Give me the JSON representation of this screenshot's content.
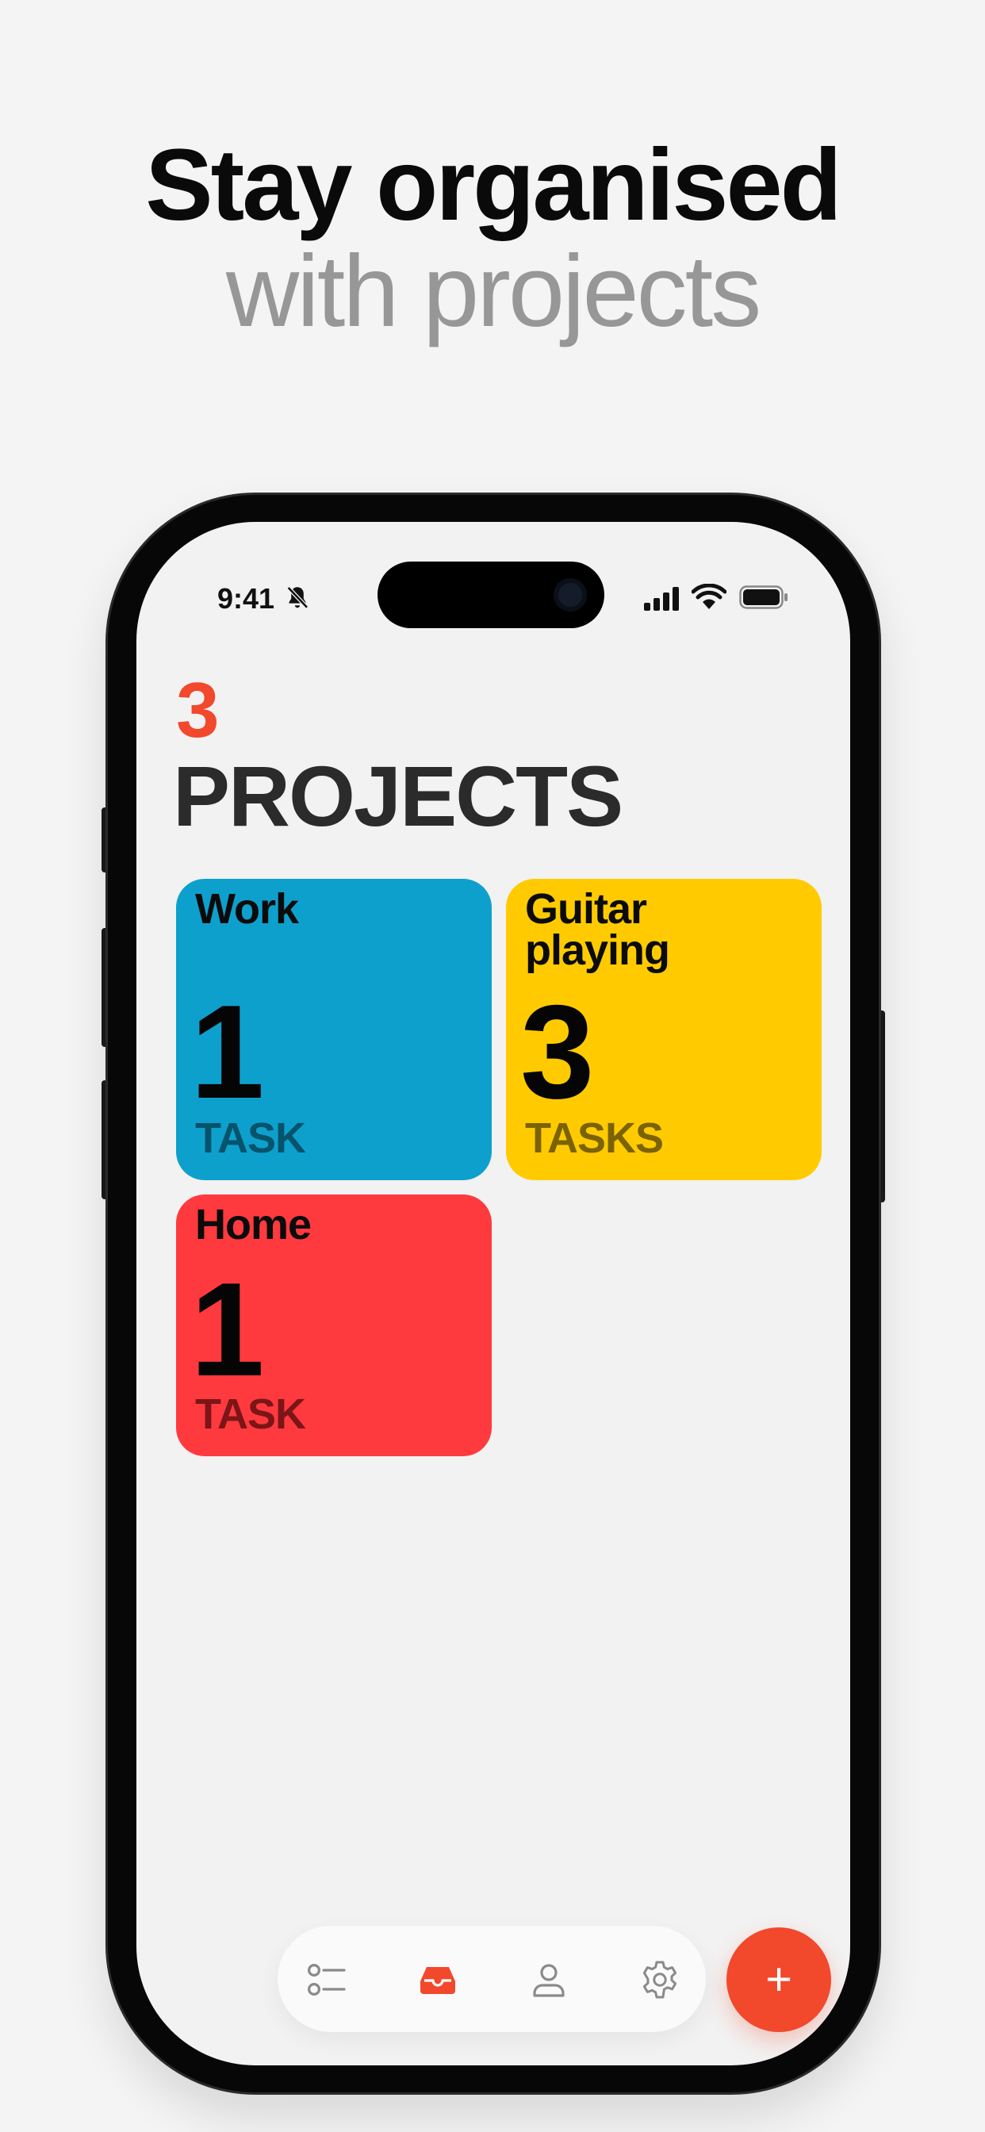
{
  "headline": {
    "line1": "Stay organised",
    "line2": "with projects"
  },
  "status_bar": {
    "time": "9:41",
    "icons": [
      "bell-slash-icon",
      "signal-icon",
      "wifi-icon",
      "battery-icon"
    ]
  },
  "projects": {
    "count": "3",
    "title": "PROJECTS",
    "items": [
      {
        "name": "Work",
        "count": "1",
        "unit": "TASK",
        "color": "#0ea0cc"
      },
      {
        "name": "Guitar playing",
        "count": "3",
        "unit": "TASKS",
        "color": "#ffcb00"
      },
      {
        "name": "Home",
        "count": "1",
        "unit": "TASK",
        "color": "#ff3a3e"
      }
    ]
  },
  "tabbar": {
    "tabs": [
      "list-icon",
      "inbox-icon",
      "profile-icon",
      "settings-icon"
    ],
    "active": "inbox-icon"
  },
  "fab": {
    "label": "+"
  },
  "colors": {
    "accent": "#f2482c",
    "background": "#f4f4f4",
    "muted_text": "#979797"
  }
}
